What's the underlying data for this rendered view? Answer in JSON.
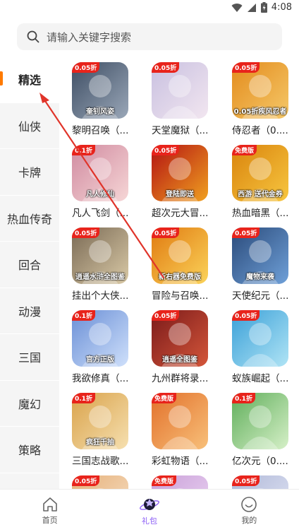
{
  "status": {
    "time": "4:08"
  },
  "search": {
    "placeholder": "请输入关键字搜索"
  },
  "sidebar": {
    "items": [
      {
        "label": "精选",
        "active": true
      },
      {
        "label": "仙侠"
      },
      {
        "label": "卡牌"
      },
      {
        "label": "热血传奇"
      },
      {
        "label": "回合"
      },
      {
        "label": "动漫"
      },
      {
        "label": "三国"
      },
      {
        "label": "魔幻"
      },
      {
        "label": "策略"
      }
    ]
  },
  "games": [
    {
      "name": "黎明召唤（...",
      "badge": "0.05折",
      "art": "奎钊风姿",
      "c1": "#3d4d63",
      "c2": "#9aa7b8"
    },
    {
      "name": "天堂魔狱（...",
      "badge": "0.05折",
      "art": "",
      "c1": "#c8c0e0",
      "c2": "#f2e6f0"
    },
    {
      "name": "侍忍者（0....",
      "badge": "0.05折",
      "art": "0.05折疾风忍者",
      "c1": "#e38b1c",
      "c2": "#f5c869"
    },
    {
      "name": "凡人飞剑（...",
      "badge": "0.1折",
      "art": "凡人修仙",
      "c1": "#d08aa0",
      "c2": "#f6d6d6"
    },
    {
      "name": "超次元大冒...",
      "badge": "0.05折",
      "art": "登陆即送",
      "c1": "#b31212",
      "c2": "#f0a020"
    },
    {
      "name": "热血暗黑（...",
      "badge": "免费版",
      "art": "西游 送代金券",
      "c1": "#d9830c",
      "c2": "#f7c640"
    },
    {
      "name": "挂出个大侠...",
      "badge": "0.05折",
      "art": "逍遥水浒全图鉴",
      "c1": "#7a6a55",
      "c2": "#d9c9a6"
    },
    {
      "name": "冒险与召唤...",
      "badge": "0.05折",
      "art": "新右器免费版",
      "c1": "#e07a10",
      "c2": "#fbd35a"
    },
    {
      "name": "天使纪元（...",
      "badge": "0.05折",
      "art": "魔物来袭",
      "c1": "#2a4a7a",
      "c2": "#6fa0d8"
    },
    {
      "name": "我欲修真（...",
      "badge": "0.1折",
      "art": "官方正版",
      "c1": "#6a8fd6",
      "c2": "#cfe0fb"
    },
    {
      "name": "九州群将录...",
      "badge": "0.05折",
      "art": "逍遥全图鉴",
      "c1": "#7a1a1a",
      "c2": "#d4563a"
    },
    {
      "name": "蚁族崛起（...",
      "badge": "0.05折",
      "art": "",
      "c1": "#3aa0d8",
      "c2": "#b0e4f5"
    },
    {
      "name": "三国志战歌...",
      "badge": "0.1折",
      "art": "疯狂千抽",
      "c1": "#d9a24a",
      "c2": "#f6e0b0"
    },
    {
      "name": "彩虹物语（...",
      "badge": "免费版",
      "art": "",
      "c1": "#e2702a",
      "c2": "#f8c07a"
    },
    {
      "name": "亿次元（0....",
      "badge": "0.1折",
      "art": "",
      "c1": "#5fae5a",
      "c2": "#d6f0c8"
    },
    {
      "name": "",
      "badge": "0.05折",
      "art": "",
      "c1": "#e6b07a",
      "c2": "#f7e2c8"
    },
    {
      "name": "",
      "badge": "免费版",
      "art": "",
      "c1": "#c9a0d8",
      "c2": "#eed8f5"
    },
    {
      "name": "",
      "badge": "0.05折",
      "art": "",
      "c1": "#b0b8d8",
      "c2": "#e4e8f6"
    }
  ],
  "tabs": [
    {
      "label": "首页",
      "icon": "home-icon"
    },
    {
      "label": "礼包",
      "icon": "gift-planet-icon",
      "active": true
    },
    {
      "label": "我的",
      "icon": "smile-icon"
    }
  ],
  "colors": {
    "accent": "#ff7a00",
    "tab_active": "#8b5cf6",
    "badge": "#e8231b",
    "annotation": "#e0342a"
  }
}
